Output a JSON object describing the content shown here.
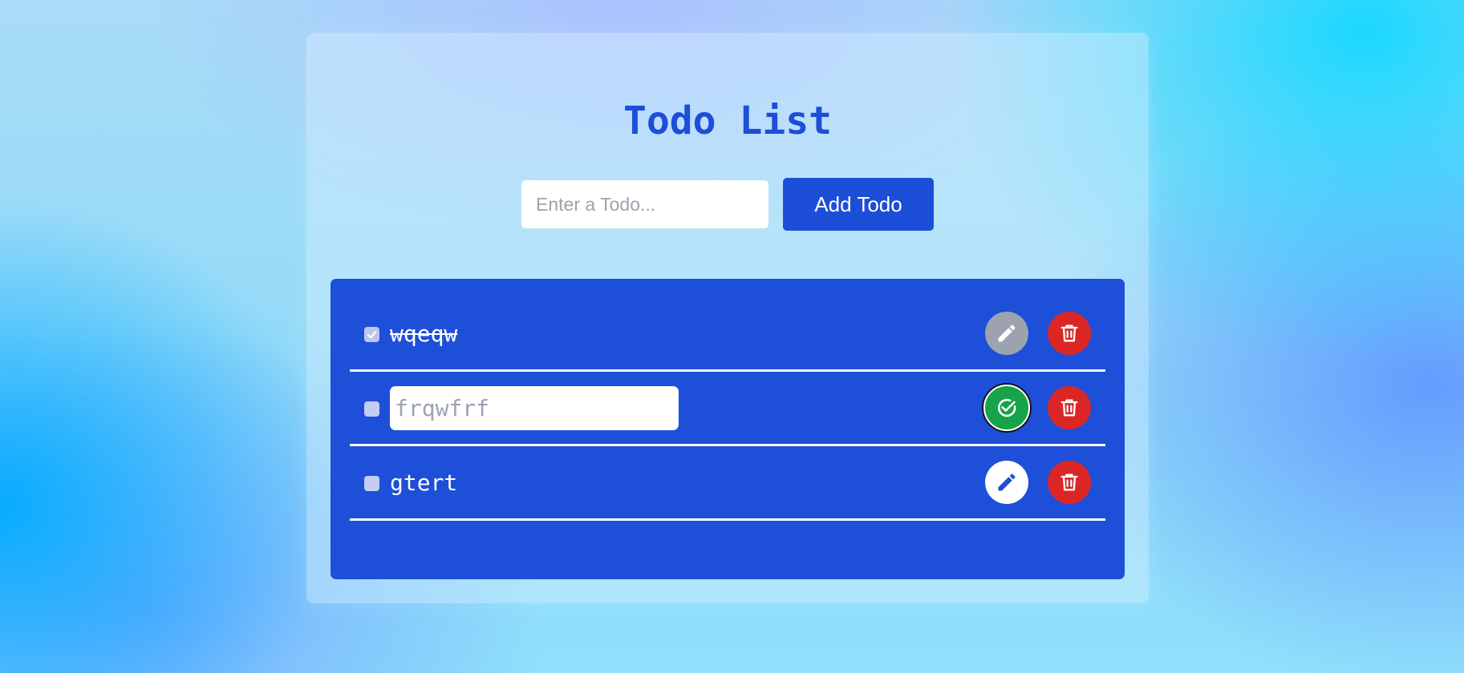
{
  "app": {
    "title": "Todo List"
  },
  "form": {
    "placeholder": "Enter a Todo...",
    "value": "",
    "add_label": "Add Todo"
  },
  "todos": [
    {
      "text": "wqeqw",
      "completed": true,
      "editing": false
    },
    {
      "text": "frqwfrf",
      "completed": false,
      "editing": true
    },
    {
      "text": "gtert",
      "completed": false,
      "editing": false
    }
  ],
  "icons": {
    "edit": "pencil-icon",
    "save": "check-circle-icon",
    "delete": "trash-icon"
  },
  "colors": {
    "accent": "#1d4ed8",
    "list_background": "#1e4fd8",
    "delete": "#dc2626",
    "save": "#16a34a",
    "disabled": "#9ca3af"
  }
}
